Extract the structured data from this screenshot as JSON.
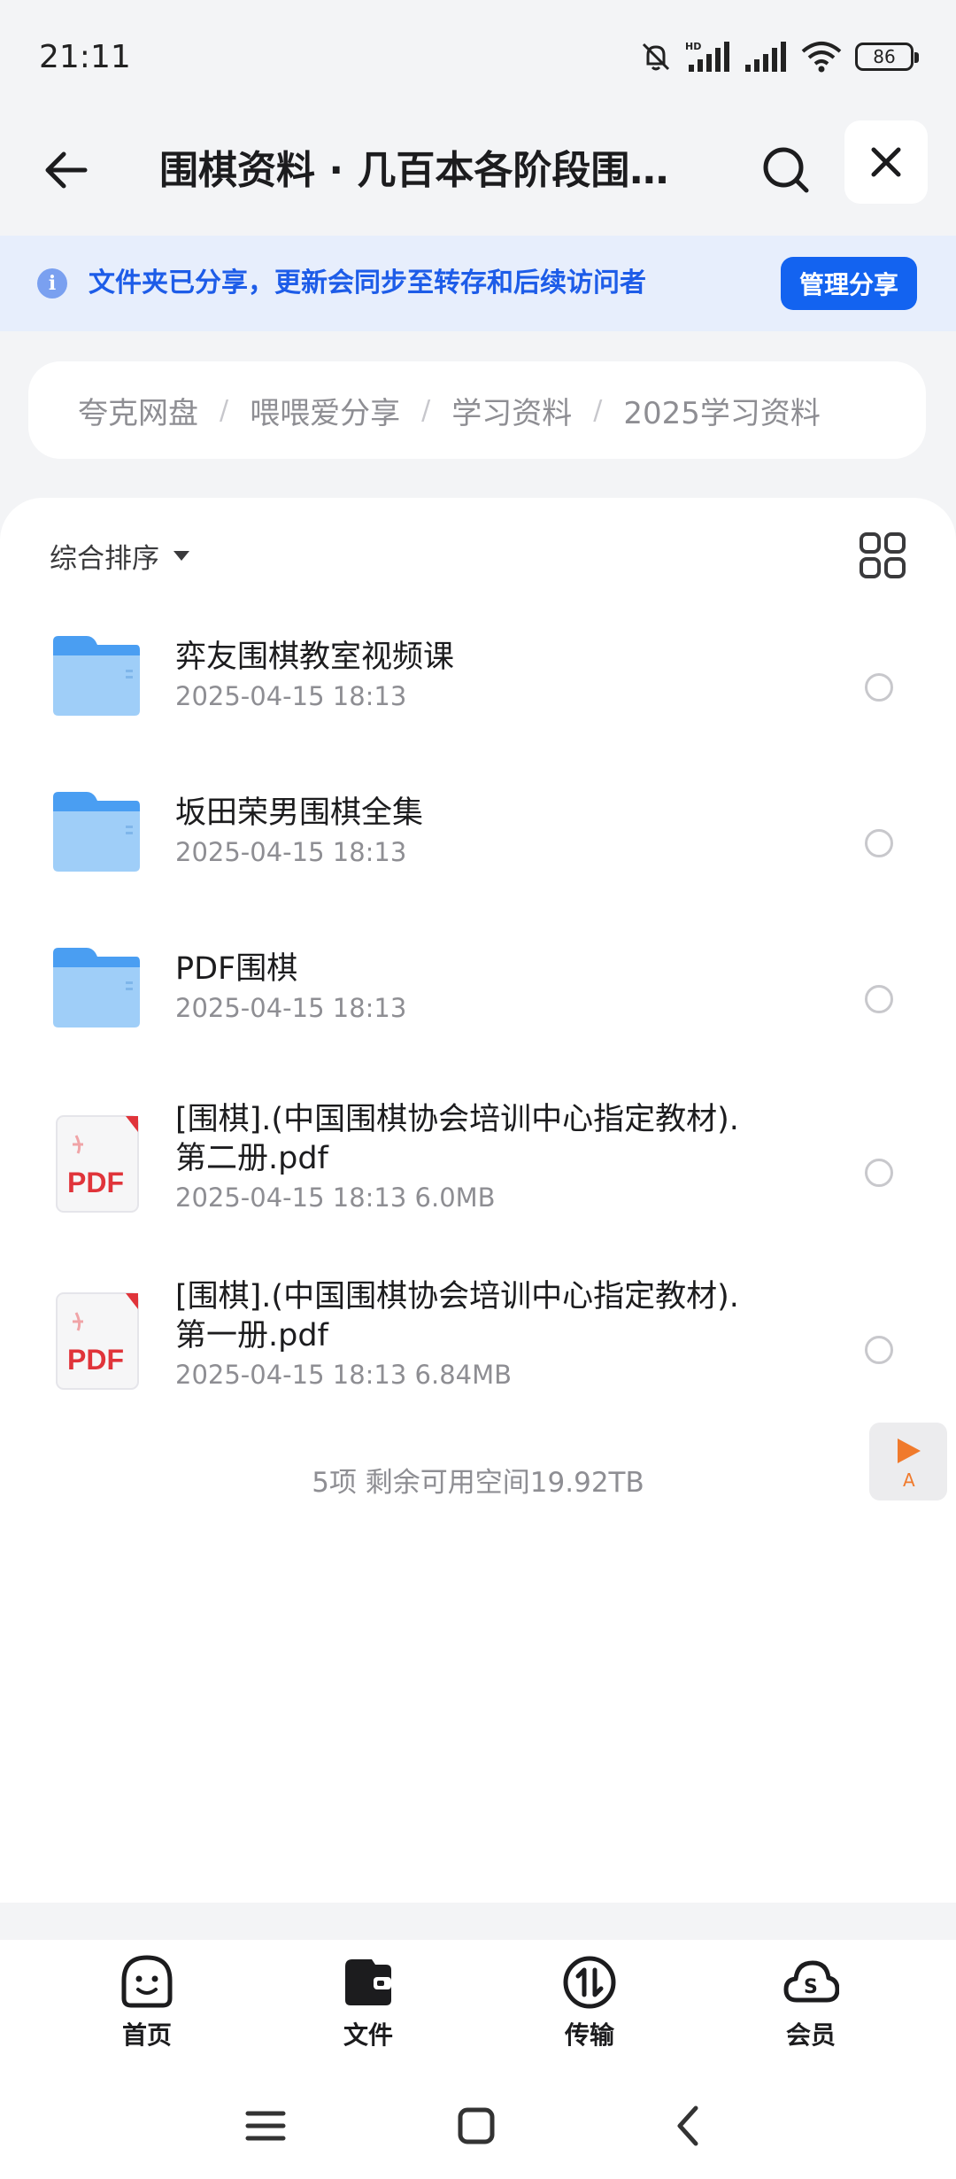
{
  "status_bar": {
    "time": "21:11",
    "battery_level": "86",
    "network_label": "HD"
  },
  "header": {
    "title": "围棋资料 · 几百本各阶段围棋书",
    "back_icon": "arrow-left-icon",
    "search_icon": "search-icon",
    "close_icon": "close-icon"
  },
  "share_banner": {
    "text": "文件夹已分享，更新会同步至转存和后续访问者",
    "button_label": "管理分享",
    "accent": "#1363f0"
  },
  "breadcrumb": {
    "items": [
      "夸克网盘",
      "喂喂爱分享",
      "学习资料",
      "2025学习资料"
    ]
  },
  "toolbar": {
    "sort_label": "综合排序",
    "view_icon": "grid-view-icon"
  },
  "files": [
    {
      "type": "folder",
      "name": "弈友围棋教室视频课",
      "meta": "2025-04-15 18:13"
    },
    {
      "type": "folder",
      "name": "坂田荣男围棋全集",
      "meta": "2025-04-15 18:13"
    },
    {
      "type": "folder",
      "name": "PDF围棋",
      "meta": "2025-04-15 18:13"
    },
    {
      "type": "pdf",
      "name_line1": "[围棋].(中国围棋协会培训中心指定教材).",
      "name_line2": "第二册.pdf",
      "meta": "2025-04-15 18:13  6.0MB",
      "badge": "PDF"
    },
    {
      "type": "pdf",
      "name_line1": "[围棋].(中国围棋协会培训中心指定教材).",
      "name_line2": "第一册.pdf",
      "meta": "2025-04-15 18:13  6.84MB",
      "badge": "PDF"
    }
  ],
  "summary": "5项 剩余可用空间19.92TB",
  "float_player": {
    "label": "A",
    "icon": "play-icon"
  },
  "bottom_nav": [
    {
      "label": "首页",
      "icon": "smiley-icon"
    },
    {
      "label": "文件",
      "icon": "wallet-folder-icon"
    },
    {
      "label": "传输",
      "icon": "transfer-icon"
    },
    {
      "label": "会员",
      "icon": "cloud-s-icon"
    }
  ]
}
